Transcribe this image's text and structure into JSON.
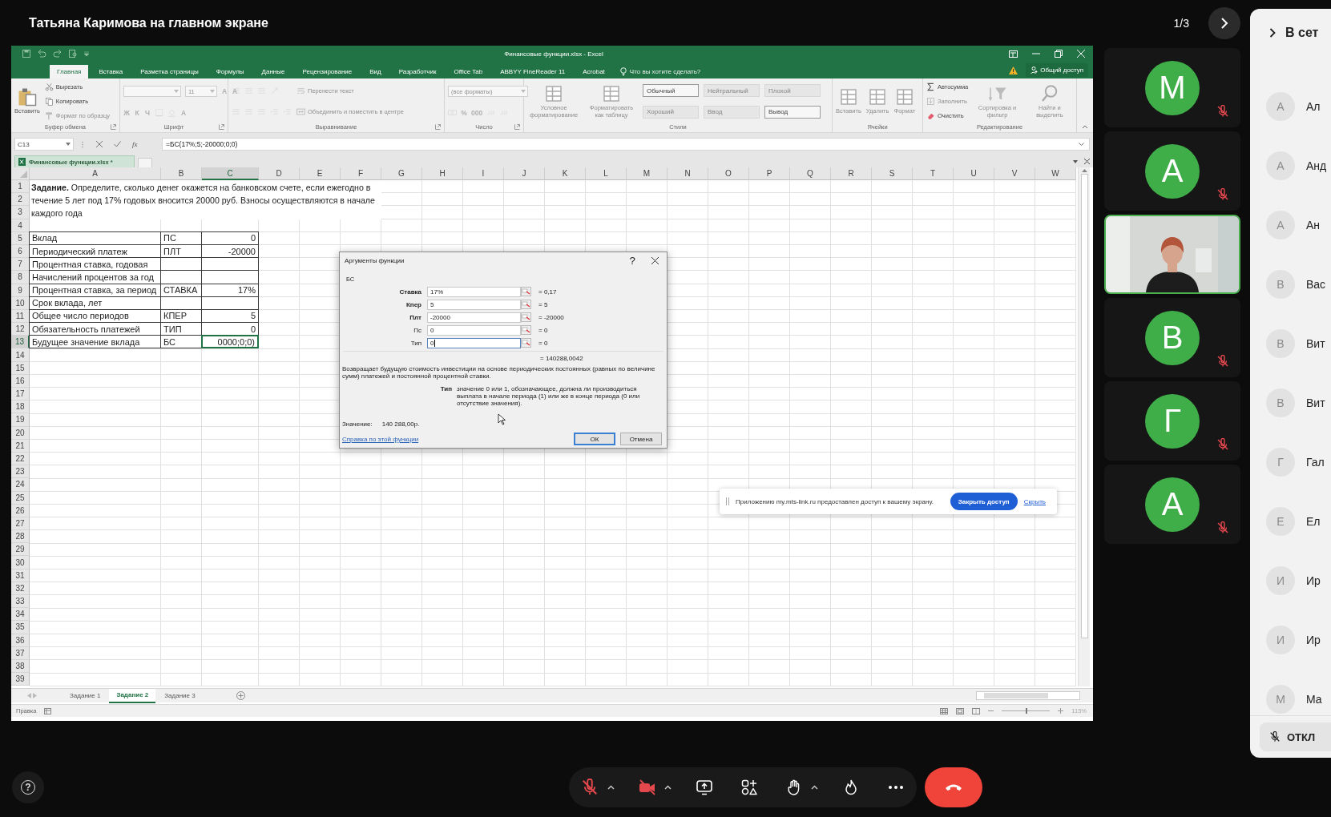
{
  "meeting": {
    "presenter_caption": "Татьяна Каримова на главном экране",
    "page_indicator": "1/3"
  },
  "excel": {
    "title": "Финансовые функции.xlsx - Excel",
    "tabs": [
      {
        "label": "Главная",
        "selected": true
      },
      {
        "label": "Вставка",
        "selected": false
      },
      {
        "label": "Разметка страницы",
        "selected": false
      },
      {
        "label": "Формулы",
        "selected": false
      },
      {
        "label": "Данные",
        "selected": false
      },
      {
        "label": "Рецензирование",
        "selected": false
      },
      {
        "label": "Вид",
        "selected": false
      },
      {
        "label": "Разработчик",
        "selected": false
      },
      {
        "label": "Office Tab",
        "selected": false
      },
      {
        "label": "ABBYY FineReader 11",
        "selected": false
      },
      {
        "label": "Acrobat",
        "selected": false
      }
    ],
    "tell_me": "Что вы хотите сделать?",
    "share": "Общий доступ",
    "ribbon": [
      {
        "label": "Буфер обмена",
        "launcher": true,
        "columns": [
          [
            {
              "kind": "paste",
              "label": "Вставить",
              "disabled": false
            }
          ],
          [
            {
              "kind": "cut",
              "label": "Вырезать",
              "disabled": false
            },
            {
              "kind": "copy",
              "label": "Копировать",
              "disabled": false
            },
            {
              "kind": "painter",
              "label": "Формат по образцу",
              "disabled": true
            }
          ]
        ]
      },
      {
        "label": "Шрифт",
        "launcher": true,
        "columns": [
          [
            {
              "kind": "row",
              "items": [
                {
                  "kind": "font",
                  "disabled": true
                },
                {
                  "kind": "size",
                  "value": "11",
                  "disabled": true
                },
                {
                  "kind": "glyph",
                  "label": "A",
                  "disabled": true
                },
                {
                  "kind": "glyph",
                  "label": "A",
                  "disabled": true
                }
              ]
            },
            {
              "kind": "row",
              "items": [
                {
                  "kind": "glyph",
                  "label": "Ж",
                  "disabled": true
                },
                {
                  "kind": "glyph",
                  "label": "К",
                  "disabled": true
                },
                {
                  "kind": "glyph",
                  "label": "Ч",
                  "disabled": true
                },
                {
                  "kind": "borders",
                  "disabled": true
                },
                {
                  "kind": "fillcolor",
                  "disabled": true
                },
                {
                  "kind": "glyph",
                  "label": "A",
                  "disabled": true
                }
              ]
            }
          ]
        ]
      },
      {
        "label": "Выравнивание",
        "launcher": true,
        "columns": [
          [
            {
              "kind": "row",
              "items": [
                {
                  "kind": "align",
                  "disabled": true
                },
                {
                  "kind": "align",
                  "disabled": true
                },
                {
                  "kind": "align",
                  "disabled": true
                },
                {
                  "kind": "orientation",
                  "disabled": true
                }
              ]
            },
            {
              "kind": "row",
              "items": [
                {
                  "kind": "align",
                  "disabled": true
                },
                {
                  "kind": "align",
                  "disabled": true
                },
                {
                  "kind": "align",
                  "disabled": true
                },
                {
                  "kind": "indent",
                  "disabled": true
                },
                {
                  "kind": "indent",
                  "disabled": true
                }
              ]
            }
          ],
          [
            {
              "kind": "wrap",
              "label": "Перенести текст",
              "disabled": true
            },
            {
              "kind": "merge",
              "label": "Объединить и поместить в центре",
              "disabled": true
            }
          ]
        ]
      },
      {
        "label": "Число",
        "launcher": true,
        "columns": [
          [
            {
              "kind": "format",
              "value": "(все форматы)",
              "disabled": true
            },
            {
              "kind": "row",
              "items": [
                {
                  "kind": "currency",
                  "disabled": true
                },
                {
                  "kind": "glyph",
                  "label": "%",
                  "disabled": true
                },
                {
                  "kind": "glyph",
                  "label": "000",
                  "disabled": true
                },
                {
                  "kind": "decimals",
                  "disabled": true
                },
                {
                  "kind": "decimals",
                  "disabled": true
                }
              ]
            }
          ]
        ]
      },
      {
        "label": "Стили",
        "launcher": false,
        "columns": [
          [
            {
              "kind": "conditional",
              "label": "Условное форматирование",
              "disabled": true
            }
          ],
          [
            {
              "kind": "table",
              "label": "Форматировать как таблицу",
              "disabled": true
            }
          ],
          [
            {
              "kind": "style",
              "label": "Обычный",
              "disabled": false
            },
            {
              "kind": "style",
              "label": "Хороший",
              "disabled": true
            }
          ],
          [
            {
              "kind": "style",
              "label": "Нейтральный",
              "disabled": true
            },
            {
              "kind": "style",
              "label": "Ввод",
              "disabled": true
            }
          ],
          [
            {
              "kind": "style",
              "label": "Плохой",
              "disabled": true
            },
            {
              "kind": "style",
              "label": "Вывод",
              "disabled": false
            }
          ]
        ]
      },
      {
        "label": "Ячейки",
        "launcher": false,
        "columns": [
          [
            {
              "kind": "insert",
              "label": "Вставить",
              "disabled": true
            }
          ],
          [
            {
              "kind": "delete",
              "label": "Удалить",
              "disabled": true
            }
          ],
          [
            {
              "kind": "cellformat",
              "label": "Формат",
              "disabled": true
            }
          ]
        ]
      },
      {
        "label": "Редактирование",
        "launcher": false,
        "columns": [
          [
            {
              "kind": "sum",
              "label": "Автосумма",
              "disabled": false
            },
            {
              "kind": "filldown",
              "label": "Заполнить",
              "disabled": true
            },
            {
              "kind": "clear",
              "label": "Очистить",
              "disabled": false
            }
          ],
          [
            {
              "kind": "sort",
              "label": "Сортировка и фильтр",
              "disabled": true
            }
          ],
          [
            {
              "kind": "find",
              "label": "Найти и выделить",
              "disabled": true
            }
          ]
        ]
      }
    ],
    "name_box": "C13",
    "insert_function": "fx",
    "formula": "=БС(17%;5;-20000;0;0)",
    "workbook_tab": "Финансовые функции.xlsx *",
    "columns": [
      {
        "label": "A",
        "selected": false
      },
      {
        "label": "B",
        "selected": false
      },
      {
        "label": "C",
        "selected": true
      },
      {
        "label": "D",
        "selected": false
      },
      {
        "label": "E",
        "selected": false
      },
      {
        "label": "F",
        "selected": false
      },
      {
        "label": "G",
        "selected": false
      },
      {
        "label": "H",
        "selected": false
      },
      {
        "label": "I",
        "selected": false
      },
      {
        "label": "J",
        "selected": false
      },
      {
        "label": "K",
        "selected": false
      },
      {
        "label": "L",
        "selected": false
      },
      {
        "label": "M",
        "selected": false
      },
      {
        "label": "N",
        "selected": false
      },
      {
        "label": "O",
        "selected": false
      },
      {
        "label": "P",
        "selected": false
      },
      {
        "label": "Q",
        "selected": false
      },
      {
        "label": "R",
        "selected": false
      },
      {
        "label": "S",
        "selected": false
      },
      {
        "label": "T",
        "selected": false
      },
      {
        "label": "U",
        "selected": false
      },
      {
        "label": "V",
        "selected": false
      },
      {
        "label": "W",
        "selected": false
      }
    ],
    "rows": [
      {
        "label": "1",
        "selected": false
      },
      {
        "label": "2",
        "selected": false
      },
      {
        "label": "3",
        "selected": false
      },
      {
        "label": "4",
        "selected": false
      },
      {
        "label": "5",
        "selected": false
      },
      {
        "label": "6",
        "selected": false
      },
      {
        "label": "7",
        "selected": false
      },
      {
        "label": "8",
        "selected": false
      },
      {
        "label": "9",
        "selected": false
      },
      {
        "label": "10",
        "selected": false
      },
      {
        "label": "11",
        "selected": false
      },
      {
        "label": "12",
        "selected": false
      },
      {
        "label": "13",
        "selected": true
      },
      {
        "label": "14",
        "selected": false
      },
      {
        "label": "15",
        "selected": false
      },
      {
        "label": "16",
        "selected": false
      },
      {
        "label": "17",
        "selected": false
      },
      {
        "label": "18",
        "selected": false
      },
      {
        "label": "19",
        "selected": false
      },
      {
        "label": "20",
        "selected": false
      },
      {
        "label": "21",
        "selected": false
      },
      {
        "label": "22",
        "selected": false
      },
      {
        "label": "23",
        "selected": false
      },
      {
        "label": "24",
        "selected": false
      },
      {
        "label": "25",
        "selected": false
      },
      {
        "label": "26",
        "selected": false
      },
      {
        "label": "27",
        "selected": false
      },
      {
        "label": "28",
        "selected": false
      },
      {
        "label": "29",
        "selected": false
      },
      {
        "label": "30",
        "selected": false
      },
      {
        "label": "31",
        "selected": false
      },
      {
        "label": "32",
        "selected": false
      },
      {
        "label": "33",
        "selected": false
      },
      {
        "label": "34",
        "selected": false
      },
      {
        "label": "35",
        "selected": false
      },
      {
        "label": "36",
        "selected": false
      },
      {
        "label": "37",
        "selected": false
      },
      {
        "label": "38",
        "selected": false
      },
      {
        "label": "39",
        "selected": false
      }
    ],
    "task": "**Задание.** Определите, сколько денег окажется на банковском счете, если ежегодно в течение 5 лет под 17% годовых вносится 20000 руб. Взносы осуществляются в начале каждого года",
    "table": [
      {
        "label": "Вклад",
        "code": "ПС",
        "value": "0",
        "selected": false
      },
      {
        "label": "Периодический платеж",
        "code": "ПЛТ",
        "value": "-20000",
        "selected": false
      },
      {
        "label": "Процентная ставка, годовая",
        "selected": false
      },
      {
        "label": "Начислений процентов за год",
        "selected": false
      },
      {
        "label": "Процентная ставка, за период",
        "code": "СТАВКА",
        "value": "17%",
        "selected": false
      },
      {
        "label": "Срок вклада, лет",
        "selected": false
      },
      {
        "label": "Общее число периодов",
        "code": "КПЕР",
        "value": "5",
        "selected": false
      },
      {
        "label": "Обязательность платежей",
        "code": "ТИП",
        "value": "0",
        "selected": false
      },
      {
        "label": "Будущее значение вклада",
        "code": "БС",
        "value": "0000;0;0)",
        "selected": true
      }
    ],
    "dialog": {
      "title": "Аргументы функции",
      "help": "?",
      "function_name": "БС",
      "args": [
        {
          "label": "Ставка",
          "value": "17%",
          "result": "= 0,17",
          "required": true,
          "focused": false
        },
        {
          "label": "Кпер",
          "value": "5",
          "result": "= 5",
          "required": true,
          "focused": false
        },
        {
          "label": "Плт",
          "value": "-20000",
          "result": "= -20000",
          "required": true,
          "focused": false
        },
        {
          "label": "Пс",
          "value": "0",
          "result": "= 0",
          "required": false,
          "focused": false
        },
        {
          "label": "Тип",
          "value": "0",
          "result": "= 0",
          "required": false,
          "focused": true
        }
      ],
      "result": "= 140288,0042",
      "description": "Возвращает будущую стоимость инвестиции на основе периодических постоянных (равных по величине сумм) платежей и постоянной процентной ставки.",
      "arg_help": {
        "label": "Тип",
        "text": "значение 0 или 1, обозначающее, должна ли производиться выплата в начале периода (1) или же в конце периода (0 или отсутствие значения)."
      },
      "value_label": "Значение:",
      "value": "140 288,00р.",
      "help_link": "Справка по этой функции",
      "buttons": [
        {
          "label": "ОК",
          "default": true
        },
        {
          "label": "Отмена",
          "default": false
        }
      ]
    },
    "sheet_tabs": [
      {
        "label": "Задание 1",
        "selected": false
      },
      {
        "label": "Задание 2",
        "selected": true
      },
      {
        "label": "Задание 3",
        "selected": false
      }
    ],
    "status": "Правка",
    "zoom": {
      "level": 0.5,
      "reading": "115%"
    }
  },
  "share_notice": {
    "text": "Приложению my.mts-link.ru предоставлен доступ к вашему экрану.",
    "button": "Закрыть доступ",
    "link": "Скрыть"
  },
  "tiles": [
    {
      "kind": "avatar",
      "initial": "М",
      "muted": true,
      "active": false
    },
    {
      "kind": "avatar",
      "initial": "А",
      "muted": true,
      "active": false
    },
    {
      "kind": "video",
      "muted": false,
      "active": true
    },
    {
      "kind": "avatar",
      "initial": "В",
      "muted": true,
      "active": false
    },
    {
      "kind": "avatar",
      "initial": "Г",
      "muted": true,
      "active": false
    },
    {
      "kind": "avatar",
      "initial": "А",
      "muted": true,
      "active": false
    }
  ],
  "panel": {
    "title": "В сет",
    "participants": [
      {
        "initial": "А",
        "name": "Ал"
      },
      {
        "initial": "А",
        "name": "Анд"
      },
      {
        "initial": "А",
        "name": "Ан"
      },
      {
        "initial": "В",
        "name": "Вас"
      },
      {
        "initial": "В",
        "name": "Вит"
      },
      {
        "initial": "В",
        "name": "Вит"
      },
      {
        "initial": "Г",
        "name": "Гал"
      },
      {
        "initial": "Е",
        "name": "Ел"
      },
      {
        "initial": "И",
        "name": "Ир"
      },
      {
        "initial": "И",
        "name": "Ир"
      },
      {
        "initial": "М",
        "name": "Ма"
      }
    ],
    "mute_button": "ОТКЛ"
  },
  "toolbar": {
    "help": "?",
    "mic_on": false,
    "camera_on": false,
    "actions": [
      {
        "kind": "share",
        "menu": false
      },
      {
        "kind": "apps",
        "menu": false
      },
      {
        "kind": "hand",
        "menu": true
      },
      {
        "kind": "reactions",
        "menu": false
      },
      {
        "kind": "more",
        "menu": false
      }
    ]
  }
}
